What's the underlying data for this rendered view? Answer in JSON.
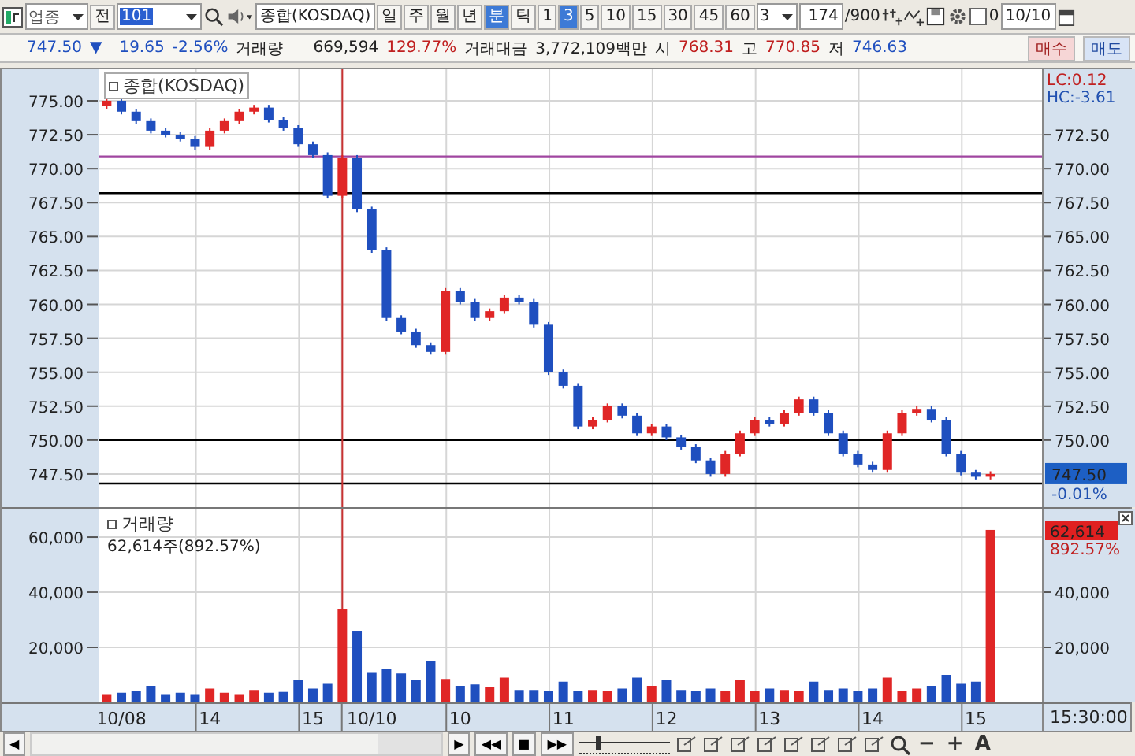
{
  "toolbar": {
    "market_select": {
      "value": "업종"
    },
    "prev_button": "전",
    "code_field": {
      "value": "101"
    },
    "name_field": {
      "value": "종합(KOSDAQ)"
    },
    "period_tabs": [
      {
        "label": "일",
        "selected": false
      },
      {
        "label": "주",
        "selected": false
      },
      {
        "label": "월",
        "selected": false
      },
      {
        "label": "년",
        "selected": false
      },
      {
        "label": "분",
        "selected": true
      },
      {
        "label": "틱",
        "selected": false
      }
    ],
    "interval_tabs": [
      {
        "label": "1",
        "selected": false
      },
      {
        "label": "3",
        "selected": true
      },
      {
        "label": "5",
        "selected": false
      },
      {
        "label": "10",
        "selected": false
      },
      {
        "label": "15",
        "selected": false
      },
      {
        "label": "30",
        "selected": false
      },
      {
        "label": "45",
        "selected": false
      },
      {
        "label": "60",
        "selected": false
      }
    ],
    "interval_select": {
      "value": "3"
    },
    "count_field": {
      "value": "174"
    },
    "count_total": "/900",
    "checkbox": {
      "label": "0",
      "checked": false
    },
    "date_field": {
      "value": "10/10"
    }
  },
  "quote": {
    "price": "747.50",
    "direction_mark": "▼",
    "change": "19.65",
    "change_rate": "-2.56%",
    "volume_label": "거래량",
    "volume": "669,594",
    "volume_rate": "129.77%",
    "value_label": "거래대금",
    "trade_value": "3,772,109백만",
    "open_label": "시",
    "open": "768.31",
    "high_label": "고",
    "high": "770.85",
    "low_label": "저",
    "low": "746.63"
  },
  "order_buttons": [
    {
      "label": "매수",
      "kind": "buy"
    },
    {
      "label": "매도",
      "kind": "sell"
    }
  ],
  "price_pane": {
    "legend": "종합(KOSDAQ)",
    "lc": "LC:0.12",
    "hc": "HC:-3.61",
    "price_tag": "747.50",
    "change_tag": "-0.01%",
    "right_ticks": [
      "772.50",
      "770.00",
      "767.50",
      "765.00",
      "762.50",
      "760.00",
      "757.50",
      "755.00",
      "752.50",
      "750.00"
    ],
    "chart_data": {
      "type": "candlestick",
      "grid": true,
      "ylim": [
        745.06,
        777.32
      ],
      "categories": [
        null,
        null,
        null,
        null,
        null,
        null,
        null,
        null,
        null,
        null,
        null,
        null,
        null,
        null,
        null,
        null,
        null,
        null,
        null,
        null,
        null,
        null,
        null,
        null,
        null,
        null,
        null,
        null,
        null,
        null,
        null,
        null,
        null,
        null,
        null,
        null,
        null,
        null,
        null,
        null,
        null,
        null,
        null,
        null,
        null,
        null,
        null,
        null,
        null,
        null,
        null,
        null,
        null,
        null,
        null,
        null,
        null,
        null,
        null,
        null,
        null,
        null,
        null,
        null
      ],
      "yticks": [
        {
          "value": 775,
          "label": "775.00"
        },
        {
          "value": 772.5,
          "label": "772.50"
        },
        {
          "value": 770,
          "label": "770.00"
        },
        {
          "value": 767.5,
          "label": "767.50"
        },
        {
          "value": 765,
          "label": "765.00"
        },
        {
          "value": 762.5,
          "label": "762.50"
        },
        {
          "value": 760,
          "label": "760.00"
        },
        {
          "value": 757.5,
          "label": "757.50"
        },
        {
          "value": 755,
          "label": "755.00"
        },
        {
          "value": 752.5,
          "label": "752.50"
        },
        {
          "value": 750,
          "label": "750.00"
        },
        {
          "value": 747.5,
          "label": "747.50"
        }
      ],
      "ohlc": [
        [
          774.6,
          775.2,
          774.4,
          775.0
        ],
        [
          775.0,
          775.2,
          774.0,
          774.2
        ],
        [
          774.2,
          774.4,
          773.3,
          773.5
        ],
        [
          773.5,
          773.7,
          772.6,
          772.8
        ],
        [
          772.8,
          773.0,
          772.3,
          772.5
        ],
        [
          772.5,
          772.7,
          772.0,
          772.2
        ],
        [
          772.2,
          772.4,
          771.4,
          771.6
        ],
        [
          771.6,
          773.0,
          771.4,
          772.8
        ],
        [
          772.8,
          773.7,
          772.6,
          773.5
        ],
        [
          773.5,
          774.4,
          773.3,
          774.2
        ],
        [
          774.2,
          774.7,
          774.0,
          774.5
        ],
        [
          774.5,
          774.7,
          773.4,
          773.6
        ],
        [
          773.6,
          773.8,
          772.8,
          773.0
        ],
        [
          773.0,
          773.2,
          771.6,
          771.8
        ],
        [
          771.8,
          772.0,
          770.8,
          771.0
        ],
        [
          771.0,
          771.2,
          767.8,
          768.0
        ],
        [
          768.0,
          771.0,
          767.8,
          770.8
        ],
        [
          770.8,
          771.0,
          766.8,
          767.0
        ],
        [
          767.0,
          767.2,
          763.8,
          764.0
        ],
        [
          764.0,
          764.2,
          758.8,
          759.0
        ],
        [
          759.0,
          759.2,
          757.8,
          758.0
        ],
        [
          758.0,
          758.2,
          756.8,
          757.0
        ],
        [
          757.0,
          757.2,
          756.3,
          756.5
        ],
        [
          756.5,
          761.2,
          756.3,
          761.0
        ],
        [
          761.0,
          761.2,
          760.0,
          760.2
        ],
        [
          760.2,
          760.4,
          758.8,
          759.0
        ],
        [
          759.0,
          759.7,
          758.8,
          759.5
        ],
        [
          759.5,
          760.7,
          759.3,
          760.5
        ],
        [
          760.5,
          760.7,
          760.0,
          760.2
        ],
        [
          760.2,
          760.4,
          758.3,
          758.5
        ],
        [
          758.5,
          758.7,
          754.8,
          755.0
        ],
        [
          755.0,
          755.2,
          753.8,
          754.0
        ],
        [
          754.0,
          754.2,
          750.8,
          751.0
        ],
        [
          751.0,
          751.7,
          750.8,
          751.5
        ],
        [
          751.5,
          752.7,
          751.3,
          752.5
        ],
        [
          752.5,
          752.7,
          751.6,
          751.8
        ],
        [
          751.8,
          752.0,
          750.3,
          750.5
        ],
        [
          750.5,
          751.2,
          750.3,
          751.0
        ],
        [
          751.0,
          751.2,
          750.0,
          750.2
        ],
        [
          750.2,
          750.4,
          749.3,
          749.5
        ],
        [
          749.5,
          749.7,
          748.3,
          748.5
        ],
        [
          748.5,
          748.7,
          747.3,
          747.5
        ],
        [
          747.5,
          749.2,
          747.3,
          749.0
        ],
        [
          749.0,
          750.7,
          748.8,
          750.5
        ],
        [
          750.5,
          751.7,
          750.3,
          751.5
        ],
        [
          751.5,
          751.7,
          751.0,
          751.2
        ],
        [
          751.2,
          752.2,
          751.0,
          752.0
        ],
        [
          752.0,
          753.2,
          751.8,
          753.0
        ],
        [
          753.0,
          753.2,
          751.8,
          752.0
        ],
        [
          752.0,
          752.2,
          750.3,
          750.5
        ],
        [
          750.5,
          750.7,
          748.8,
          749.0
        ],
        [
          749.0,
          749.2,
          748.0,
          748.2
        ],
        [
          748.2,
          748.4,
          747.6,
          747.8
        ],
        [
          747.8,
          750.7,
          747.6,
          750.5
        ],
        [
          750.5,
          752.2,
          750.3,
          752.0
        ],
        [
          752.0,
          752.5,
          751.8,
          752.3
        ],
        [
          752.3,
          752.5,
          751.3,
          751.5
        ],
        [
          751.5,
          751.7,
          748.8,
          749.0
        ],
        [
          749.0,
          749.2,
          747.4,
          747.6
        ],
        [
          747.6,
          747.8,
          747.1,
          747.3
        ],
        [
          747.3,
          747.7,
          747.1,
          747.5
        ],
        null,
        null,
        null
      ],
      "ref_lines": [
        {
          "value": 770.9,
          "axis": "y",
          "color": "#a046a0"
        },
        {
          "value": 768.2,
          "axis": "y",
          "color": "#000000"
        },
        {
          "value": 750,
          "axis": "y",
          "color": "#000000"
        },
        {
          "value": 746.8,
          "axis": "y",
          "color": "#000000"
        }
      ]
    }
  },
  "volume_pane": {
    "legend": "거래량",
    "reading": "62,614주(892.57%)",
    "volume_tag": "62,614",
    "rate_tag": "892.57%",
    "right_ticks": [
      "40,000",
      "20,000"
    ],
    "chart_data": {
      "type": "bar",
      "grid": true,
      "ylim": [
        0,
        70300
      ],
      "categories": [
        null,
        "10/08",
        null,
        null,
        null,
        null,
        null,
        "14",
        null,
        null,
        null,
        null,
        null,
        null,
        "15",
        null,
        null,
        null,
        "10/10",
        null,
        null,
        null,
        null,
        null,
        "10",
        null,
        null,
        null,
        null,
        null,
        null,
        "11",
        null,
        null,
        null,
        null,
        null,
        null,
        "12",
        null,
        null,
        null,
        null,
        null,
        null,
        "13",
        null,
        null,
        null,
        null,
        null,
        null,
        "14",
        null,
        null,
        null,
        null,
        null,
        null,
        "15",
        null,
        null,
        null,
        null
      ],
      "yticks": [
        {
          "value": 60000,
          "label": "60,000"
        },
        {
          "value": 40000,
          "label": "40,000"
        },
        {
          "value": 20000,
          "label": "20,000"
        }
      ],
      "values": [
        3000,
        3500,
        4000,
        6000,
        3000,
        3500,
        3000,
        5000,
        3500,
        3000,
        4500,
        3500,
        3800,
        8000,
        5000,
        7000,
        34000,
        26000,
        11000,
        12000,
        10500,
        8000,
        15000,
        8500,
        6000,
        6500,
        5500,
        9000,
        4500,
        4500,
        4000,
        7500,
        4000,
        4500,
        4000,
        5000,
        9000,
        6000,
        8000,
        4500,
        4000,
        5000,
        4000,
        8000,
        4000,
        5000,
        4500,
        4000,
        7500,
        4500,
        5000,
        4000,
        5000,
        9000,
        4000,
        5000,
        6000,
        10000,
        7000,
        7500,
        62600,
        null,
        null,
        null
      ]
    }
  },
  "x_axis": {
    "time": "15:30:00"
  },
  "bottom_bar": {
    "scroll_left": "◀",
    "playback": [
      "▶",
      "◀◀",
      "■",
      "▶▶"
    ],
    "zoom_slider": {
      "level": 0.2
    },
    "zoom_out": "−",
    "zoom_in": "+",
    "font_button": "A"
  }
}
